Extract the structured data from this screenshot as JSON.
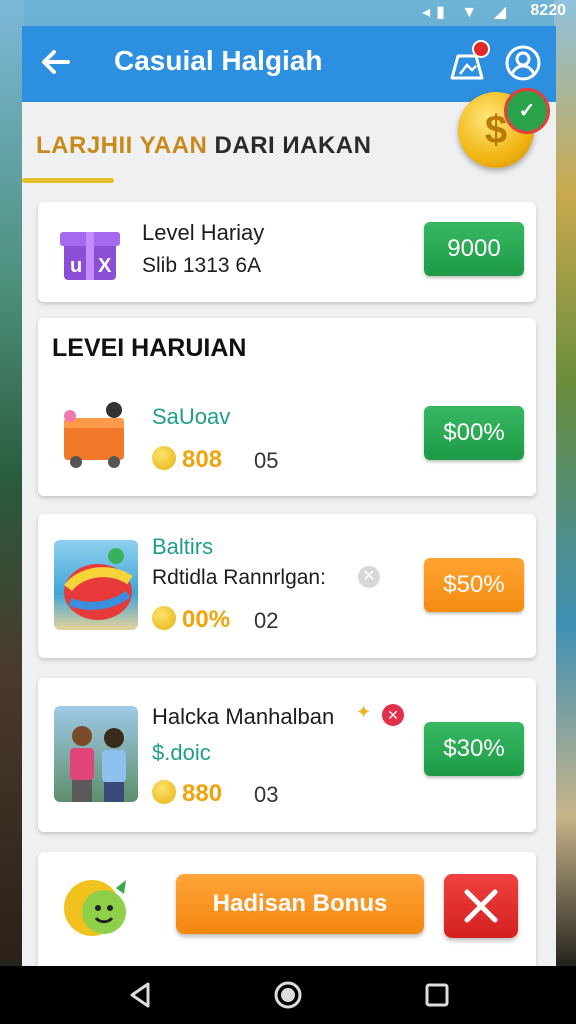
{
  "status_bar": {
    "icons": "◂▮ ▼ ◢",
    "time": "8220"
  },
  "header": {
    "back_icon": "arrow-left-icon",
    "title": "Casuial Halgiah"
  },
  "section": {
    "title_accent": "LARJHII YAAN",
    "title_rest": " DARI ИAKAN"
  },
  "featured": {
    "name": "Level Hariay",
    "detail": "Slib 1313   6A",
    "price": "9000"
  },
  "daily": {
    "heading": "LEVEI HARUIAN",
    "items": [
      {
        "title": "SaUoav",
        "coins": "808",
        "count": "05",
        "price": "$00%",
        "button_color": "green"
      },
      {
        "title": "Baltirs",
        "subtitle": "Rdtidla Rannrlgan:",
        "coins": "00%",
        "count": "02",
        "price": "$50%",
        "button_color": "orange"
      },
      {
        "title": "Halcka Manhalban",
        "subtitle": "$.doic",
        "coins": "880",
        "count": "03",
        "price": "$30%",
        "button_color": "green"
      }
    ]
  },
  "bonus": {
    "button_label": "Hadisan Bonus",
    "close_icon": "close-x-icon"
  },
  "colors": {
    "primary": "#2c8fe0",
    "green": "#1e9a47",
    "orange": "#f48a10",
    "red": "#d42020",
    "coin": "#f0a30a"
  }
}
